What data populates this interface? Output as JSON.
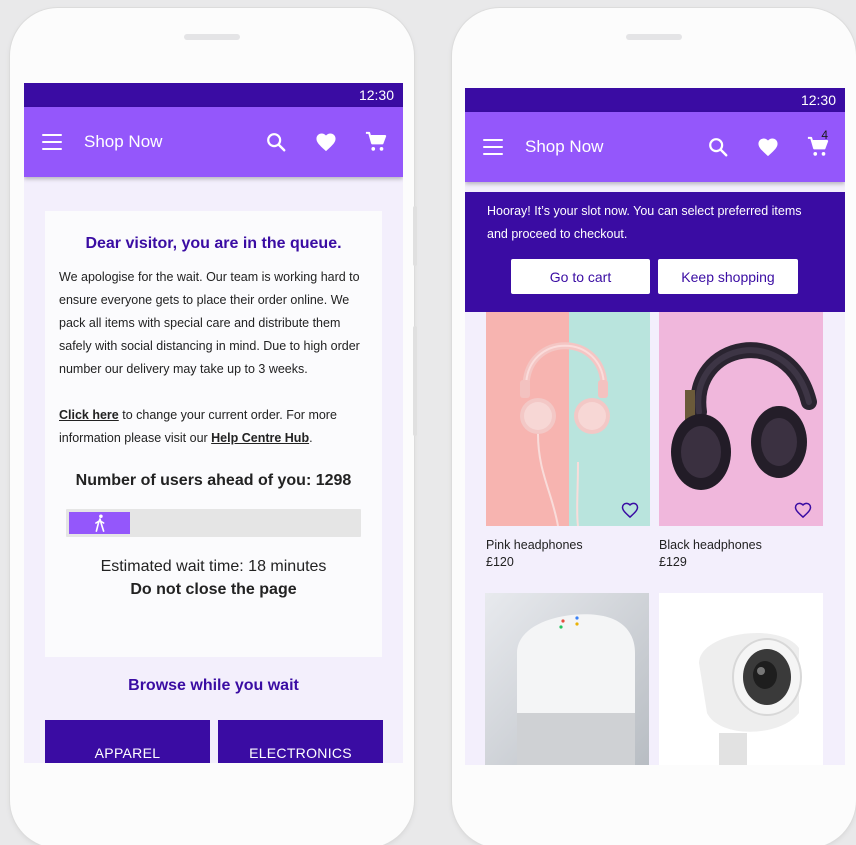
{
  "status_time": "12:30",
  "app_title": "Shop Now",
  "cart_count": "4",
  "queue": {
    "title": "Dear visitor, you are in the queue.",
    "paragraph": "We apologise for the wait. Our team is working hard to ensure everyone gets to place their order online. We pack all items with special care and distribute them safely with social distancing in mind. Due to high order number our delivery may take up to 3 weeks.",
    "link_text": "Click here",
    "change_text": " to change your current order. For more information please visit our ",
    "help_link": "Help Centre Hub",
    "period": ".",
    "users_ahead": "Number of users ahead of you: 1298",
    "progress_fraction": 0.21,
    "estimated": "Estimated wait time: 18 minutes",
    "do_not_close": "Do not close the page"
  },
  "browse": {
    "title": "Browse while you wait",
    "categories": [
      "APPAREL",
      "ELECTRONICS"
    ]
  },
  "banner": {
    "text": "Hooray! It’s your slot now. You can select preferred items and proceed to checkout.",
    "go_to_cart": "Go to cart",
    "keep_shopping": "Keep shopping"
  },
  "products": [
    {
      "name": "Pink headphones",
      "price": "£120"
    },
    {
      "name": "Black headphones",
      "price": "£129"
    },
    {
      "name": "",
      "price": ""
    },
    {
      "name": "",
      "price": ""
    }
  ],
  "colors": {
    "primary_dark": "#3a0ca3",
    "primary": "#9457fb",
    "background": "#f3effc"
  },
  "icons": [
    "menu-icon",
    "search-icon",
    "heart-icon",
    "cart-icon",
    "walking-person-icon",
    "heart-outline-icon"
  ]
}
